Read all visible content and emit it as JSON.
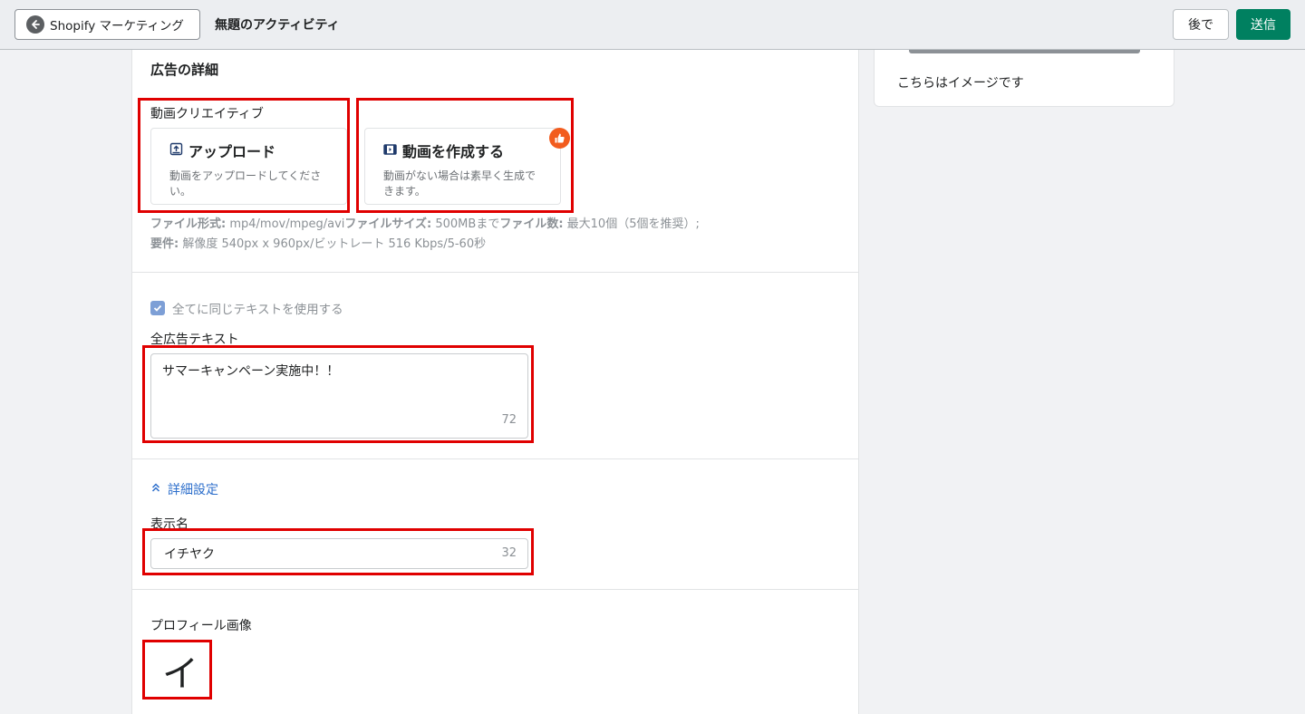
{
  "topbar": {
    "back_label": "Shopify マーケティング",
    "title": "無題のアクティビティ",
    "later_label": "後で",
    "send_label": "送信"
  },
  "details": {
    "section_title": "広告の詳細",
    "creative_label": "動画クリエイティブ",
    "upload": {
      "title": "アップロード",
      "desc": "動画をアップロードしてください。"
    },
    "create": {
      "title": "動画を作成する",
      "desc": "動画がない場合は素早く生成できます。"
    },
    "hint_line1": {
      "format_label": "ファイル形式:",
      "format_value": " mp4/mov/mpeg/avi",
      "size_label": "ファイルサイズ:",
      "size_value": " 500MBまで",
      "count_label": "ファイル数:",
      "count_value": " 最大10個（5個を推奨）;"
    },
    "hint_line2": {
      "req_label": "要件:",
      "req_value": " 解像度 540px x 960px/ビットレート 516 Kbps/5-60秒"
    }
  },
  "text_section": {
    "checkbox_label": "全てに同じテキストを使用する",
    "all_text_label": "全広告テキスト",
    "all_text_value": "サマーキャンペーン実施中！！",
    "all_text_count": "72"
  },
  "advanced": {
    "link_label": "詳細設定",
    "display_name_label": "表示名",
    "display_name_value": "イチヤク",
    "display_name_count": "32"
  },
  "profile": {
    "label": "プロフィール画像",
    "avatar_char": "イ"
  },
  "side": {
    "caption": "こちらはイメージです"
  },
  "colors": {
    "primary": "#008060",
    "link": "#2c6ecb",
    "highlight": "#e00000",
    "badge": "#f25c1e"
  }
}
